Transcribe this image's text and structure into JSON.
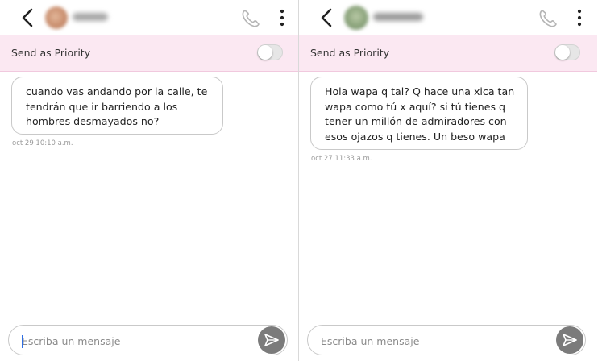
{
  "colors": {
    "priority_bar": "#fbe8f2",
    "priority_border": "#f1c9de",
    "bubble_border": "#c9c9c9",
    "send_button": "#7b7b7b",
    "timestamp": "#9a9a9a",
    "icon": "#222222",
    "phone_icon": "#b5b5b5"
  },
  "icons": {
    "back": "chevron-left-icon",
    "phone": "phone-icon",
    "menu": "more-vertical-icon",
    "send": "paper-plane-icon"
  },
  "panels": [
    {
      "priority_label": "Send as Priority",
      "priority_on": false,
      "messages": [
        {
          "lines": [
            "cuando vas andando por la calle, te",
            "tendrán que ir barriendo a los",
            "hombres desmayados no?"
          ],
          "timestamp": "oct 29 10:10 a.m."
        }
      ],
      "composer": {
        "placeholder": "Escriba un mensaje",
        "value": ""
      }
    },
    {
      "priority_label": "Send as Priority",
      "priority_on": false,
      "messages": [
        {
          "lines": [
            "Hola wapa q tal? Q hace una xica tan",
            "wapa como tú x aquí? si tú tienes q",
            "tener un millón de admiradores con",
            "esos ojazos q tienes. Un beso wapa"
          ],
          "timestamp": "oct 27 11:33 a.m."
        }
      ],
      "composer": {
        "placeholder": "Escriba un mensaje",
        "value": ""
      }
    }
  ]
}
